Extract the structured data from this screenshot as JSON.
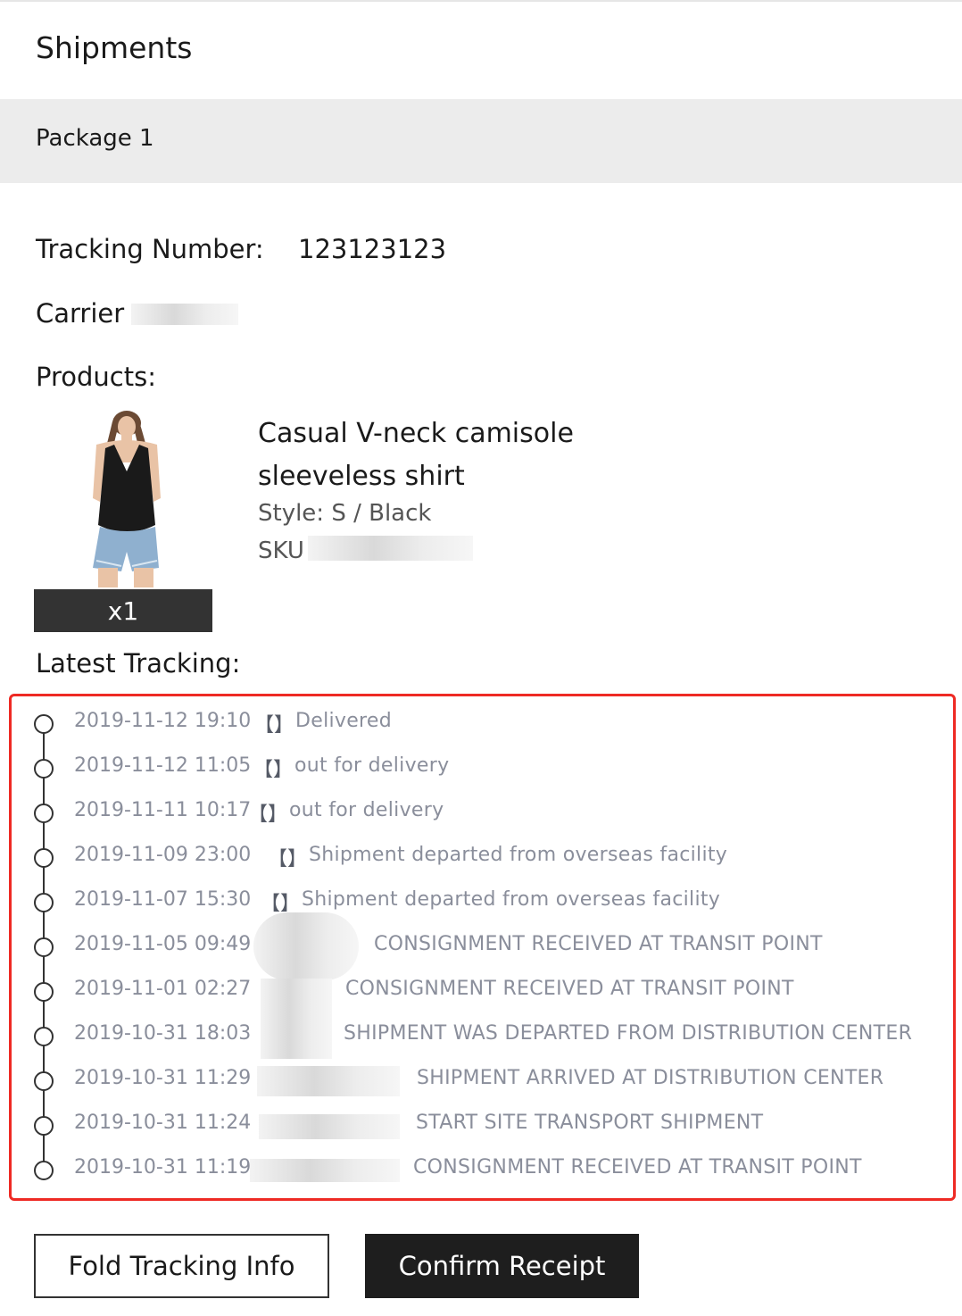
{
  "page_title": "Shipments",
  "package_label": "Package 1",
  "tracking": {
    "label": "Tracking Number:",
    "number": "123123123"
  },
  "carrier": {
    "label": "Carrier"
  },
  "products_label": "Products:",
  "product": {
    "name": "Casual V-neck camisole sleeveless shirt",
    "style": "Style: S / Black",
    "sku_label": "SKU",
    "quantity": "x1"
  },
  "latest_tracking_label": "Latest Tracking:",
  "tracking_events": [
    {
      "time": "2019-11-12 19:10",
      "bracket": "【】",
      "status": "Delivered"
    },
    {
      "time": "2019-11-12 11:05",
      "bracket": "【】",
      "status": "out for delivery"
    },
    {
      "time": "2019-11-11 10:17",
      "bracket": "【】",
      "status": "out for delivery"
    },
    {
      "time": "2019-11-09 23:00",
      "bracket": "【】",
      "status": "Shipment departed from overseas facility"
    },
    {
      "time": "2019-11-07 15:30",
      "bracket": "【】",
      "status": "Shipment departed from overseas facility"
    },
    {
      "time": "2019-11-05 09:49",
      "bracket": "",
      "status": "CONSIGNMENT RECEIVED AT TRANSIT POINT"
    },
    {
      "time": "2019-11-01 02:27",
      "bracket": "",
      "status": "CONSIGNMENT RECEIVED AT TRANSIT POINT"
    },
    {
      "time": "2019-10-31 18:03",
      "bracket": "",
      "status": "SHIPMENT WAS DEPARTED FROM DISTRIBUTION CENTER"
    },
    {
      "time": "2019-10-31 11:29",
      "bracket": "",
      "status": "SHIPMENT ARRIVED AT DISTRIBUTION CENTER"
    },
    {
      "time": "2019-10-31 11:24",
      "bracket": "",
      "status": "START SITE TRANSPORT SHIPMENT"
    },
    {
      "time": "2019-10-31 11:19",
      "bracket": "",
      "status": "CONSIGNMENT RECEIVED AT TRANSIT POINT"
    }
  ],
  "buttons": {
    "fold": "Fold Tracking Info",
    "confirm": "Confirm Receipt"
  },
  "colors": {
    "highlight_border": "#ee2a24",
    "package_bar": "#ececec",
    "quantity_badge": "#333333",
    "timeline_text": "#8a8e9b"
  }
}
